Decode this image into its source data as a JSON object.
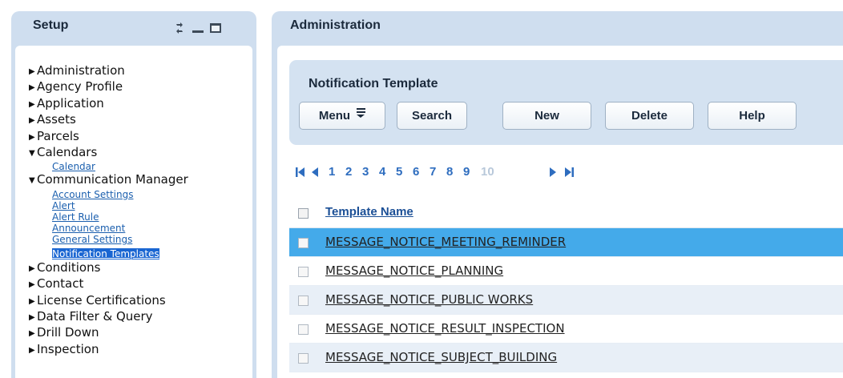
{
  "setup_panel": {
    "title": "Setup",
    "tree": [
      {
        "label": "Administration",
        "expanded": false,
        "children": []
      },
      {
        "label": "Agency Profile",
        "expanded": false,
        "children": []
      },
      {
        "label": "Application",
        "expanded": false,
        "children": []
      },
      {
        "label": "Assets",
        "expanded": false,
        "children": []
      },
      {
        "label": "Parcels",
        "expanded": false,
        "children": []
      },
      {
        "label": "Calendars",
        "expanded": true,
        "children": [
          "Calendar"
        ]
      },
      {
        "label": "Communication Manager",
        "expanded": true,
        "children": [
          "Account Settings",
          "Alert",
          "Alert Rule",
          "Announcement",
          "General Settings",
          "Notification Templates"
        ]
      },
      {
        "label": "Conditions",
        "expanded": false,
        "children": []
      },
      {
        "label": "Contact",
        "expanded": false,
        "children": []
      },
      {
        "label": "License Certifications",
        "expanded": false,
        "children": []
      },
      {
        "label": "Data Filter & Query",
        "expanded": false,
        "children": []
      },
      {
        "label": "Drill Down",
        "expanded": false,
        "children": []
      },
      {
        "label": "Inspection",
        "expanded": false,
        "children": []
      }
    ],
    "selected_child": "Notification Templates"
  },
  "admin_panel": {
    "title": "Administration",
    "section_title": "Notification Template",
    "buttons": {
      "menu": "Menu",
      "search": "Search",
      "new": "New",
      "delete": "Delete",
      "help": "Help"
    },
    "pagination": {
      "pages": [
        "1",
        "2",
        "3",
        "4",
        "5",
        "6",
        "7",
        "8",
        "9",
        "10"
      ],
      "current_page": "10"
    },
    "table": {
      "column_header": "Template Name",
      "rows": [
        "MESSAGE_NOTICE_MEETING_REMINDER",
        "MESSAGE_NOTICE_PLANNING",
        "MESSAGE_NOTICE_PUBLIC WORKS",
        "MESSAGE_NOTICE_RESULT_INSPECTION",
        "MESSAGE_NOTICE_SUBJECT_BUILDING"
      ],
      "selected_row": 0
    }
  },
  "colors": {
    "panel_bg": "#cfdeef",
    "selected_row": "#44aaea",
    "selected_tree_item": "#1a66d2",
    "link": "#2e6dbf"
  }
}
